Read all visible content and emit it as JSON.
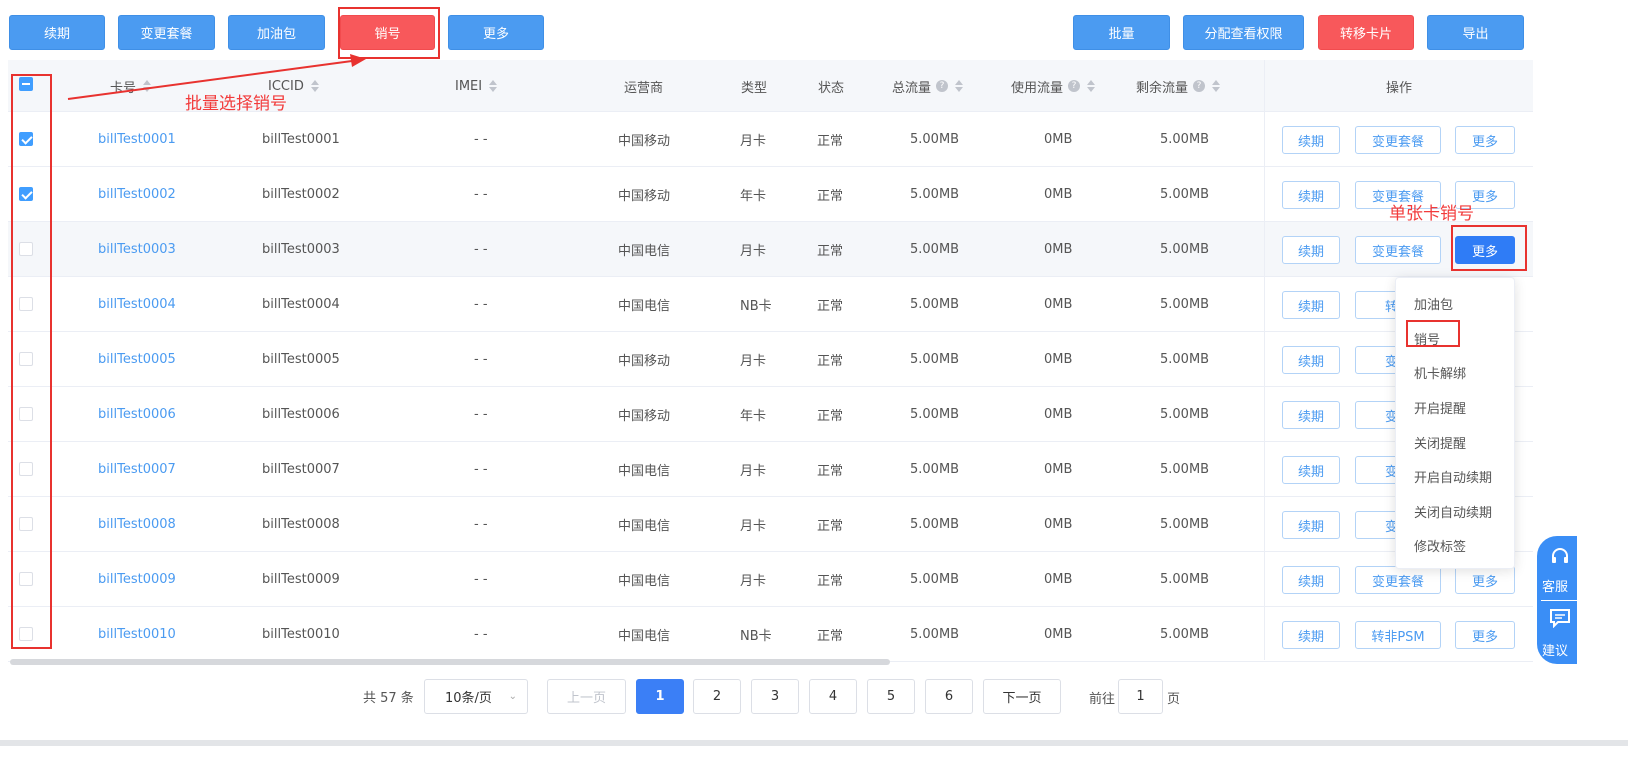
{
  "toolbar": {
    "left": [
      "续期",
      "变更套餐",
      "加油包",
      "销号",
      "更多"
    ],
    "right": [
      "批量",
      "分配查看权限",
      "转移卡片",
      "导出"
    ]
  },
  "columns": {
    "card": "卡号",
    "iccid": "ICCID",
    "imei": "IMEI",
    "carrier": "运营商",
    "type": "类型",
    "status": "状态",
    "total": "总流量",
    "used": "使用流量",
    "remain": "剩余流量",
    "ops": "操作"
  },
  "rows": [
    {
      "card": "billTest0001",
      "iccid": "billTest0001",
      "imei": "- -",
      "carrier": "中国移动",
      "type": "月卡",
      "status": "正常",
      "total": "5.00MB",
      "used": "0MB",
      "remain": "5.00MB",
      "checked": true
    },
    {
      "card": "billTest0002",
      "iccid": "billTest0002",
      "imei": "- -",
      "carrier": "中国移动",
      "type": "年卡",
      "status": "正常",
      "total": "5.00MB",
      "used": "0MB",
      "remain": "5.00MB",
      "checked": true
    },
    {
      "card": "billTest0003",
      "iccid": "billTest0003",
      "imei": "- -",
      "carrier": "中国电信",
      "type": "月卡",
      "status": "正常",
      "total": "5.00MB",
      "used": "0MB",
      "remain": "5.00MB",
      "checked": false
    },
    {
      "card": "billTest0004",
      "iccid": "billTest0004",
      "imei": "- -",
      "carrier": "中国电信",
      "type": "NB卡",
      "status": "正常",
      "total": "5.00MB",
      "used": "0MB",
      "remain": "5.00MB",
      "checked": false
    },
    {
      "card": "billTest0005",
      "iccid": "billTest0005",
      "imei": "- -",
      "carrier": "中国移动",
      "type": "月卡",
      "status": "正常",
      "total": "5.00MB",
      "used": "0MB",
      "remain": "5.00MB",
      "checked": false
    },
    {
      "card": "billTest0006",
      "iccid": "billTest0006",
      "imei": "- -",
      "carrier": "中国移动",
      "type": "年卡",
      "status": "正常",
      "total": "5.00MB",
      "used": "0MB",
      "remain": "5.00MB",
      "checked": false
    },
    {
      "card": "billTest0007",
      "iccid": "billTest0007",
      "imei": "- -",
      "carrier": "中国电信",
      "type": "月卡",
      "status": "正常",
      "total": "5.00MB",
      "used": "0MB",
      "remain": "5.00MB",
      "checked": false
    },
    {
      "card": "billTest0008",
      "iccid": "billTest0008",
      "imei": "- -",
      "carrier": "中国电信",
      "type": "月卡",
      "status": "正常",
      "total": "5.00MB",
      "used": "0MB",
      "remain": "5.00MB",
      "checked": false
    },
    {
      "card": "billTest0009",
      "iccid": "billTest0009",
      "imei": "- -",
      "carrier": "中国电信",
      "type": "月卡",
      "status": "正常",
      "total": "5.00MB",
      "used": "0MB",
      "remain": "5.00MB",
      "checked": false
    },
    {
      "card": "billTest0010",
      "iccid": "billTest0010",
      "imei": "- -",
      "carrier": "中国电信",
      "type": "NB卡",
      "status": "正常",
      "total": "5.00MB",
      "used": "0MB",
      "remain": "5.00MB",
      "checked": false
    }
  ],
  "row_ops": [
    [
      "续期",
      "变更套餐",
      "更多"
    ],
    [
      "续期",
      "变更套餐",
      "更多"
    ],
    [
      "续期",
      "变更套餐",
      "更多"
    ],
    [
      "续期",
      "转非",
      ""
    ],
    [
      "续期",
      "变更",
      ""
    ],
    [
      "续期",
      "变更",
      ""
    ],
    [
      "续期",
      "变更",
      ""
    ],
    [
      "续期",
      "变更",
      ""
    ],
    [
      "续期",
      "变更套餐",
      "更多"
    ],
    [
      "续期",
      "转非PSM",
      "更多"
    ]
  ],
  "dropdown": [
    "加油包",
    "销号",
    "机卡解绑",
    "开启提醒",
    "关闭提醒",
    "开启自动续期",
    "关闭自动续期",
    "修改标签"
  ],
  "annotations": {
    "batch": "批量选择销号",
    "single": "单张卡销号"
  },
  "pagination": {
    "total": "共 57 条",
    "page_size": "10条/页",
    "prev": "上一页",
    "pages": [
      "1",
      "2",
      "3",
      "4",
      "5",
      "6"
    ],
    "next": "下一页",
    "goto_label": "前往",
    "goto_value": "1",
    "goto_suffix": "页"
  },
  "side_tools": [
    "客服",
    "建议"
  ],
  "colors": {
    "primary": "#4b9bf1",
    "danger": "#f8585b",
    "annotation": "#e8322f"
  }
}
